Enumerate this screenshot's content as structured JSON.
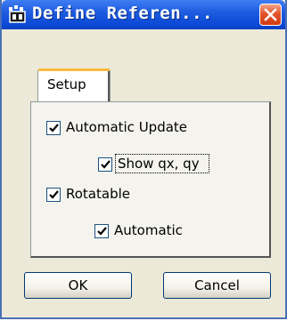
{
  "window": {
    "title": "Define Referen...",
    "icon": "app-window-icon",
    "close_icon": "close-x-icon"
  },
  "tabs": [
    {
      "label": "Setup",
      "selected": true
    }
  ],
  "options": {
    "automatic_update": {
      "label": "Automatic Update",
      "checked": true
    },
    "show_qx_qy": {
      "label": "Show qx, qy",
      "checked": true
    },
    "rotatable": {
      "label": "Rotatable",
      "checked": true
    },
    "automatic": {
      "label": "Automatic",
      "checked": true
    }
  },
  "buttons": {
    "ok": "OK",
    "cancel": "Cancel"
  },
  "colors": {
    "titlebar": "#0a48d6",
    "close": "#e2532c",
    "tab_highlight": "#fbb940",
    "background": "#ece9d8"
  }
}
